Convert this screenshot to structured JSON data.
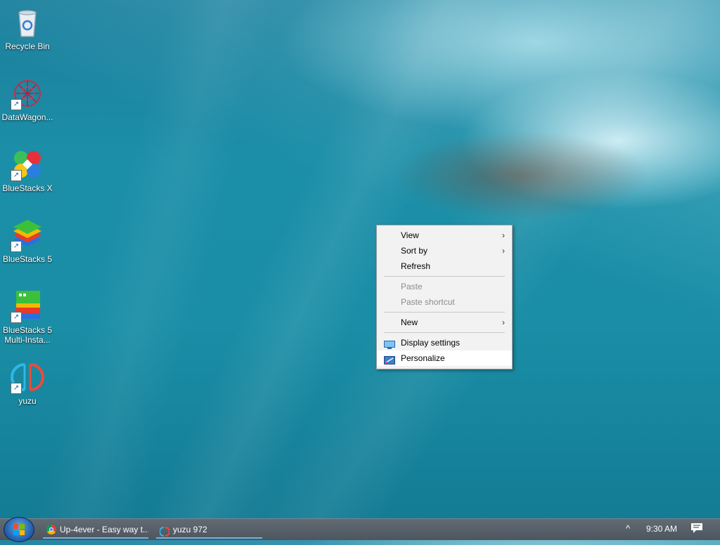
{
  "desktop": {
    "icons": [
      {
        "label": "Recycle Bin",
        "icon": "recycle-bin-icon"
      },
      {
        "label": "DataWagon...",
        "icon": "datawagon-icon"
      },
      {
        "label": "BlueStacks X",
        "icon": "bluestacks-x-icon"
      },
      {
        "label": "BlueStacks 5",
        "icon": "bluestacks-5-icon"
      },
      {
        "label": "BlueStacks 5 Multi-Insta...",
        "icon": "bluestacks-multi-instance-icon"
      },
      {
        "label": "yuzu",
        "icon": "yuzu-icon"
      }
    ]
  },
  "context_menu": {
    "items": [
      {
        "label": "View",
        "submenu": true
      },
      {
        "label": "Sort by",
        "submenu": true
      },
      {
        "label": "Refresh"
      },
      {
        "label": "Paste",
        "disabled": true
      },
      {
        "label": "Paste shortcut",
        "disabled": true
      },
      {
        "label": "New",
        "submenu": true
      },
      {
        "label": "Display settings",
        "icon": "display-icon"
      },
      {
        "label": "Personalize",
        "icon": "personalize-icon",
        "highlighted": true
      }
    ],
    "submenu_glyph": "›"
  },
  "taskbar": {
    "tasks": [
      {
        "label": "Up-4ever - Easy way t...",
        "icon": "chrome-icon"
      },
      {
        "label": "yuzu 972",
        "icon": "yuzu-icon"
      }
    ],
    "tray_chevron": "^",
    "clock": "9:30 AM"
  },
  "colors": {
    "accent": "#6fb3e8",
    "menu_bg": "#f2f2f2",
    "taskbar_bg": "#555d66"
  }
}
